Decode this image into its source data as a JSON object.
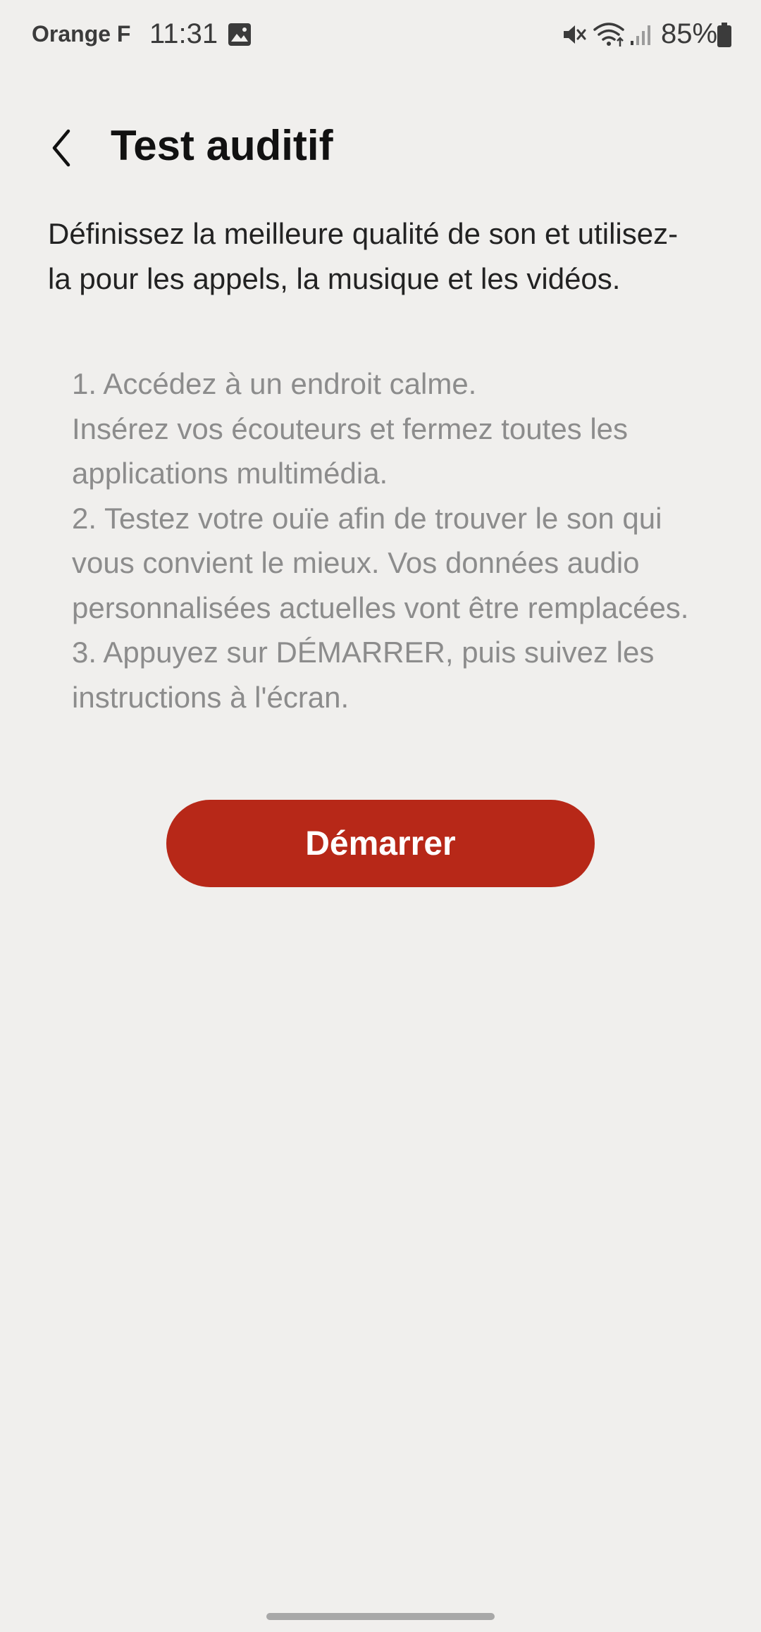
{
  "status_bar": {
    "carrier": "Orange F",
    "time": "11:31",
    "battery": "85%",
    "icons": [
      "gallery-icon",
      "mute-icon",
      "wifi-icon",
      "signal-icon",
      "battery-icon"
    ]
  },
  "header": {
    "back_icon": "chevron-left-icon",
    "title": "Test auditif"
  },
  "intro": "Définissez la meilleure qualité de son et utilisez-la pour les appels, la musique et les vidéos.",
  "steps": [
    "1. Accédez à un endroit calme.",
    "Insérez vos écouteurs et fermez toutes les applications multimédia.",
    "2. Testez votre ouïe afin de trouver le son qui vous convient le mieux. Vos données audio personnalisées actuelles vont être remplacées.",
    "3. Appuyez sur DÉMARRER, puis suivez les instructions à l'écran."
  ],
  "start_button": "Démarrer",
  "colors": {
    "background": "#f0efed",
    "accent": "#b72818",
    "steps_text": "#8c8c8c"
  }
}
